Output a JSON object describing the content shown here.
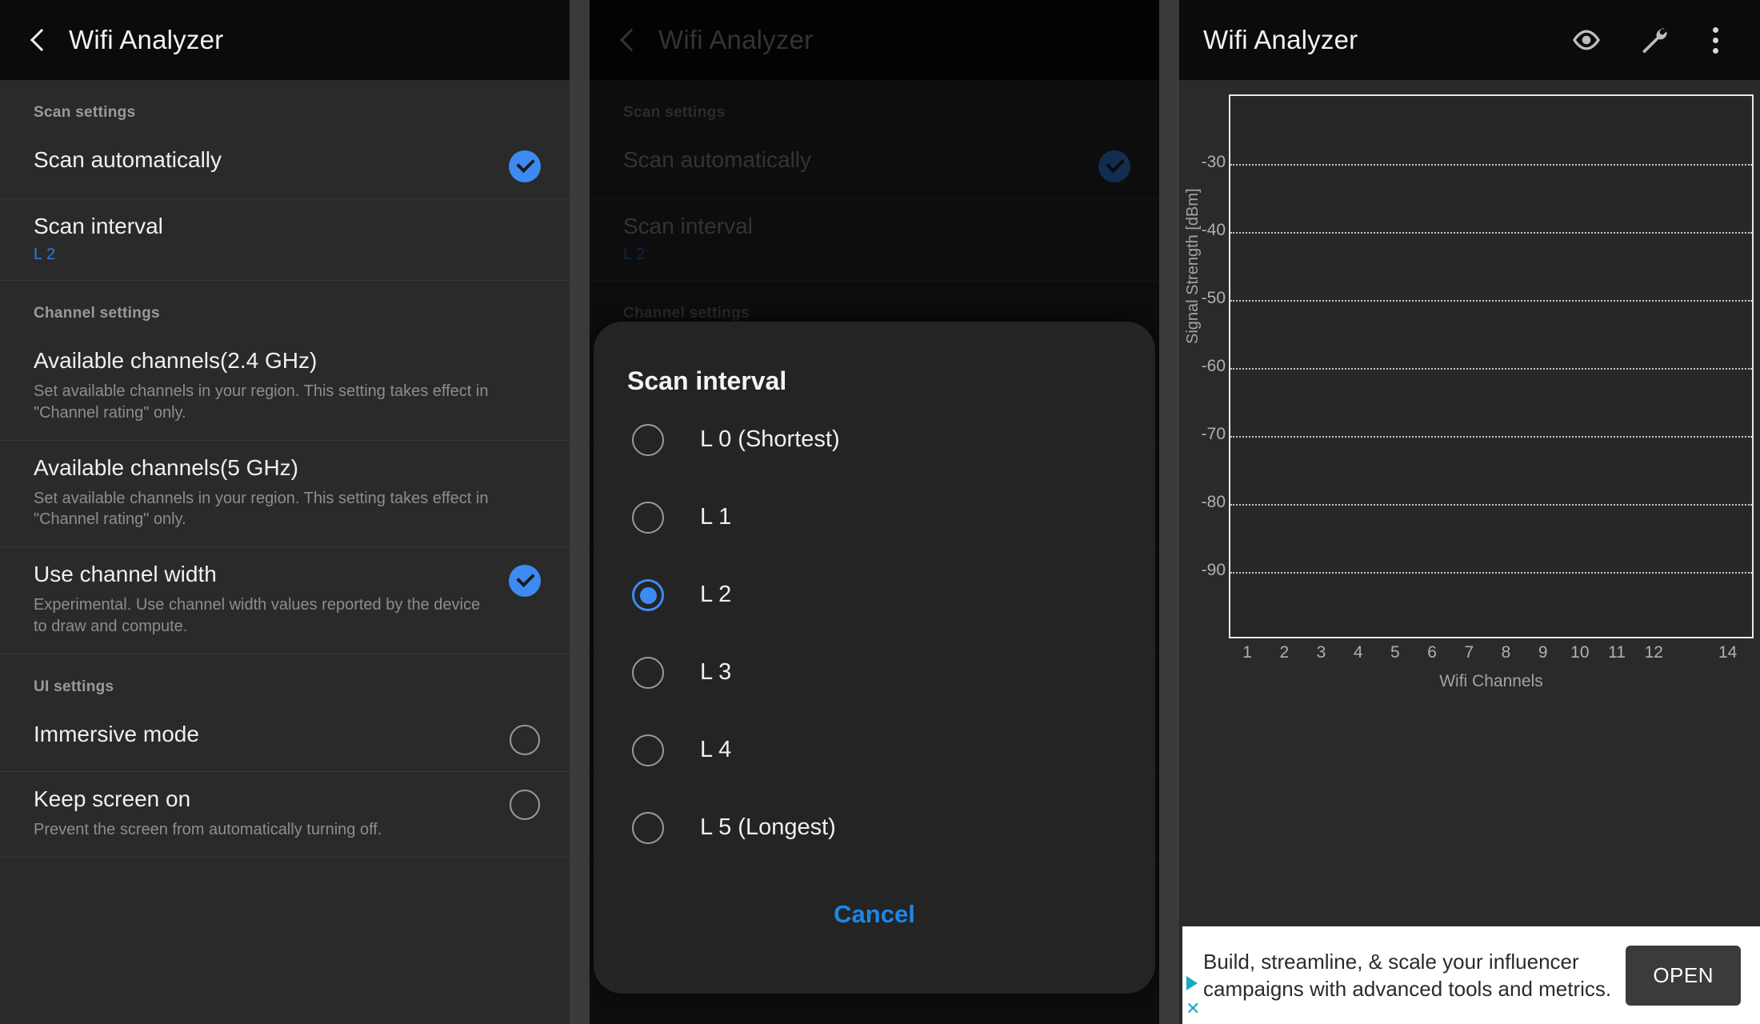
{
  "app": {
    "title": "Wifi Analyzer"
  },
  "panel_settings": {
    "back_icon": "back-chevron-icon",
    "sections": [
      {
        "header": "Scan settings",
        "rows": [
          {
            "title": "Scan automatically",
            "sub": "",
            "value": "",
            "control": "checkbox",
            "checked": true
          },
          {
            "title": "Scan interval",
            "sub": "",
            "value": "L 2",
            "control": "none",
            "checked": false
          }
        ]
      },
      {
        "header": "Channel settings",
        "rows": [
          {
            "title": "Available channels(2.4 GHz)",
            "sub": "Set available channels in your region. This setting takes effect in \"Channel rating\" only.",
            "value": "",
            "control": "none",
            "checked": false
          },
          {
            "title": "Available channels(5 GHz)",
            "sub": "Set available channels in your region. This setting takes effect in \"Channel rating\" only.",
            "value": "",
            "control": "none",
            "checked": false
          },
          {
            "title": "Use channel width",
            "sub": "Experimental. Use channel width values reported by the device to draw and compute.",
            "value": "",
            "control": "checkbox",
            "checked": true
          }
        ]
      },
      {
        "header": "UI settings",
        "rows": [
          {
            "title": "Immersive mode",
            "sub": "",
            "value": "",
            "control": "checkbox",
            "checked": false
          },
          {
            "title": "Keep screen on",
            "sub": "Prevent the screen from automatically turning off.",
            "value": "",
            "control": "checkbox",
            "checked": false
          }
        ]
      }
    ]
  },
  "dialog": {
    "title": "Scan interval",
    "options": [
      {
        "label": "L 0 (Shortest)",
        "selected": false
      },
      {
        "label": "L 1",
        "selected": false
      },
      {
        "label": "L 2",
        "selected": true
      },
      {
        "label": "L 3",
        "selected": false
      },
      {
        "label": "L 4",
        "selected": false
      },
      {
        "label": "L 5 (Longest)",
        "selected": false
      }
    ],
    "cancel_label": "Cancel"
  },
  "panel_chart": {
    "icons": [
      "eye-icon",
      "wrench-icon",
      "overflow-menu-icon"
    ]
  },
  "chart_data": {
    "type": "line",
    "title": "",
    "xlabel": "Wifi Channels",
    "ylabel": "Signal Strength [dBm]",
    "ylim": [
      -100,
      -20
    ],
    "yticks": [
      -30,
      -40,
      -50,
      -60,
      -70,
      -80,
      -90
    ],
    "ytick_labels": [
      "-30",
      "-40",
      "-50",
      "-60",
      "-70",
      "-80",
      "-90"
    ],
    "xlim": [
      0.5,
      14.7
    ],
    "xticks": [
      1,
      2,
      3,
      4,
      5,
      6,
      7,
      8,
      9,
      10,
      11,
      12,
      14
    ],
    "xtick_labels": [
      "1",
      "2",
      "3",
      "4",
      "5",
      "6",
      "7",
      "8",
      "9",
      "10",
      "11",
      "12",
      "14"
    ],
    "grid": true,
    "legend": "none",
    "series": []
  },
  "ad": {
    "text": "Build, streamline, & scale your influencer campaigns with advanced tools and metrics.",
    "open_label": "OPEN",
    "play_icon": "ad-choices-play-icon",
    "close_icon": "ad-close-icon"
  }
}
